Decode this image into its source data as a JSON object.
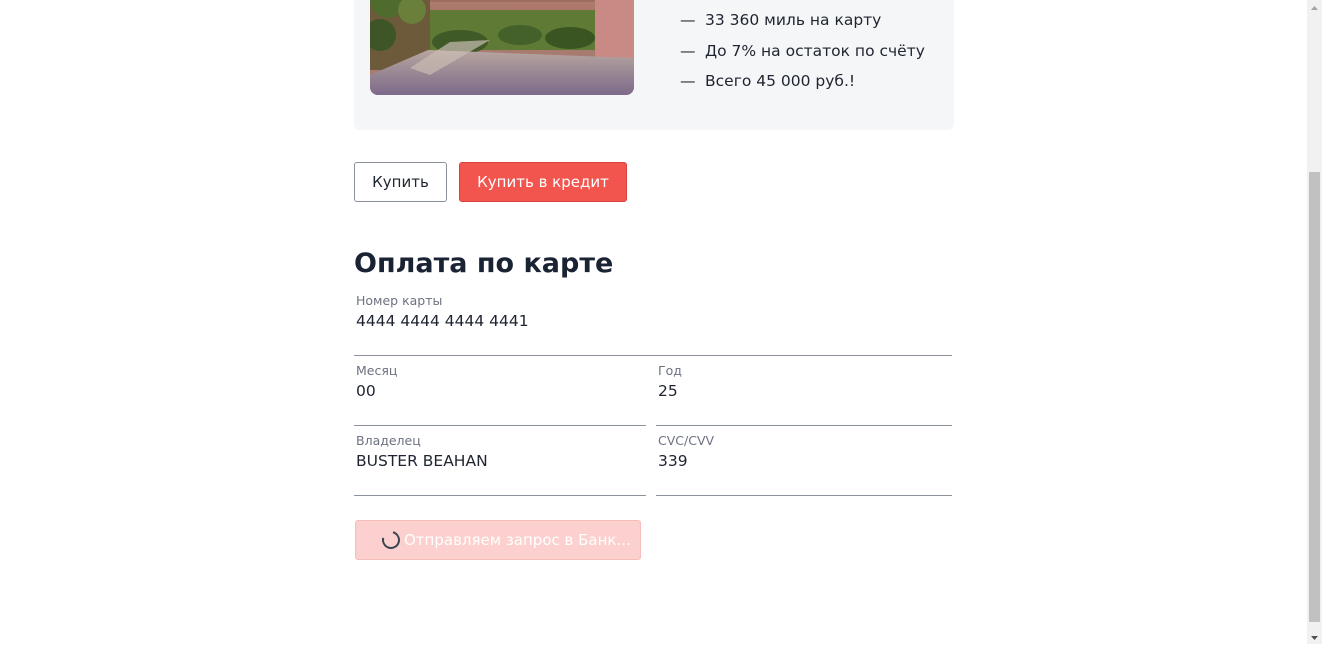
{
  "tour": {
    "features": [
      {
        "dash": "—",
        "text": "33 360 миль на карту"
      },
      {
        "dash": "—",
        "text": "До 7% на остаток по счёту"
      },
      {
        "dash": "—",
        "text": "Всего 45 000 руб.!"
      }
    ]
  },
  "actions": {
    "buy_label": "Купить",
    "credit_label": "Купить в кредит"
  },
  "payment": {
    "title": "Оплата по карте",
    "card_number": {
      "label": "Номер карты",
      "value": "4444 4444 4444 4441"
    },
    "month": {
      "label": "Месяц",
      "value": "00"
    },
    "year": {
      "label": "Год",
      "value": "25"
    },
    "owner": {
      "label": "Владелец",
      "value": "BUSTER BEAHAN"
    },
    "cvc": {
      "label": "CVC/CVV",
      "value": "339"
    },
    "submit_label": "Отправляем запрос в Банк..."
  },
  "icons": {
    "spinner": "loading-spinner-icon",
    "scroll_up": "scroll-up-arrow-icon",
    "scroll_down": "scroll-down-arrow-icon"
  },
  "colors": {
    "accent": "#f2554e",
    "accent_disabled": "#fbd0ce",
    "card_background": "#f5f6f8",
    "text": "#1e2430"
  }
}
